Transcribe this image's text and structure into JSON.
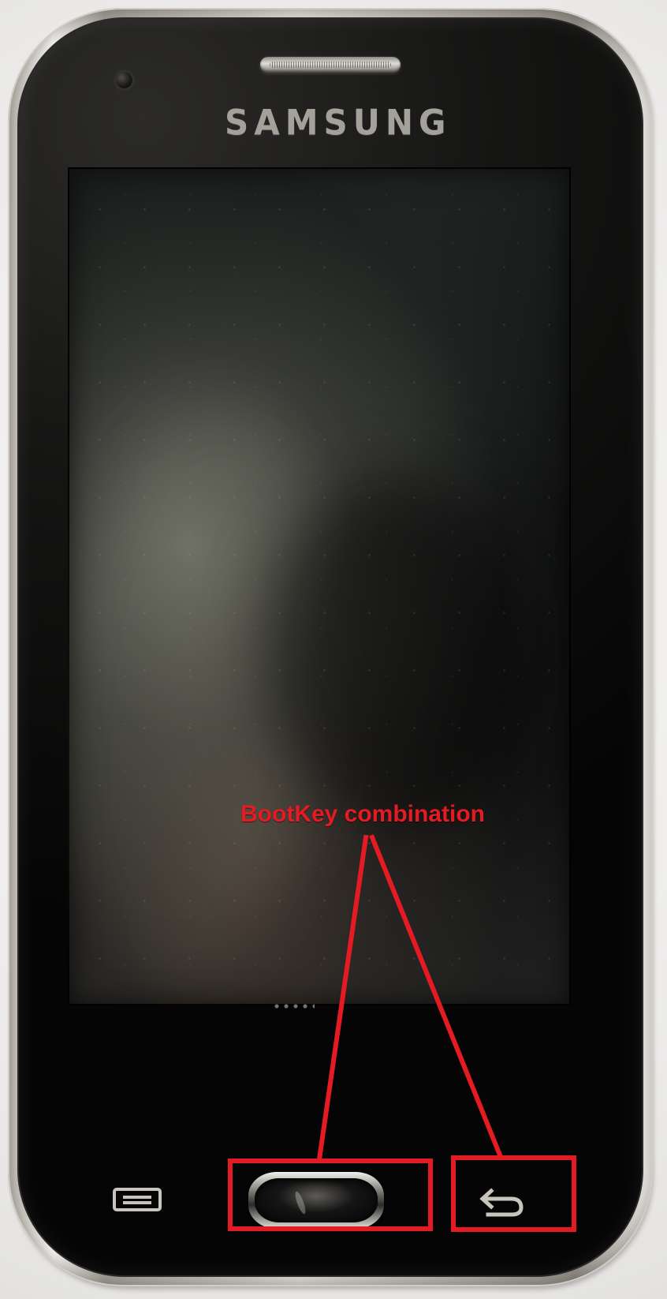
{
  "device": {
    "brand_logo": "SAMSUNG"
  },
  "annotation": {
    "label": "BootKey combination",
    "color": "#e51b24",
    "highlighted_keys": [
      "home-button",
      "back-button"
    ]
  },
  "buttons": {
    "menu_icon": "menu-icon",
    "home_icon": "home-button",
    "back_icon": "back-arrow-icon"
  },
  "colors": {
    "phone_body": "#070707",
    "screen": "#111211",
    "silver_trim": "#d9d6d0",
    "key_icon": "#c8c5bd"
  }
}
